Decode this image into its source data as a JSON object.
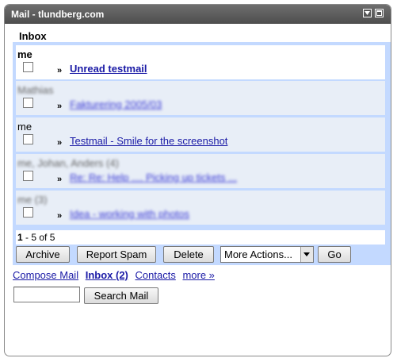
{
  "titlebar": {
    "title": "Mail - tlundberg.com",
    "menu_icon": "dropdown-menu-icon",
    "maximize_icon": "maximize-icon"
  },
  "folder": {
    "label": "Inbox"
  },
  "messages": [
    {
      "sender": "me",
      "subject": "Unread testmail",
      "unread": true,
      "blurred": false
    },
    {
      "sender": "Mathias",
      "subject": "Fakturering 2005/03",
      "unread": false,
      "blurred": true
    },
    {
      "sender": "me",
      "subject": "Testmail - Smile for the screenshot",
      "unread": false,
      "blurred": false
    },
    {
      "sender": "me, Johan, Anders (4)",
      "subject": "Re: Re: Help .... Picking up tickets ...",
      "unread": false,
      "blurred": true
    },
    {
      "sender": "me (3)",
      "subject": "Idea - working with photos",
      "unread": false,
      "blurred": true
    }
  ],
  "pagination": {
    "range": "1",
    "rest": "- 5 of 5"
  },
  "actions": {
    "archive": "Archive",
    "report_spam": "Report Spam",
    "delete": "Delete",
    "more_actions": "More Actions...",
    "go": "Go"
  },
  "links": {
    "compose": "Compose Mail",
    "inbox": "Inbox (2)",
    "contacts": "Contacts",
    "more": "more »"
  },
  "search": {
    "value": "",
    "button": "Search Mail"
  }
}
